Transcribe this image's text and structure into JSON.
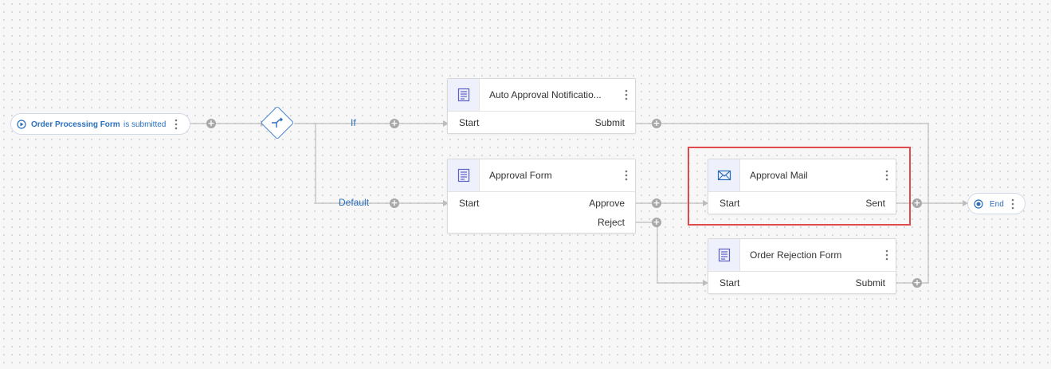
{
  "trigger": {
    "form_name": "Order Processing Form",
    "event": "is submitted"
  },
  "branches": {
    "if_label": "If",
    "default_label": "Default"
  },
  "nodes": {
    "auto_approval": {
      "title": "Auto Approval Notificatio...",
      "icon": "form-icon",
      "port_in": "Start",
      "port_out": "Submit"
    },
    "approval_form": {
      "title": "Approval Form",
      "icon": "form-icon",
      "port_in": "Start",
      "port_out_1": "Approve",
      "port_out_2": "Reject"
    },
    "approval_mail": {
      "title": "Approval Mail",
      "icon": "mail-icon",
      "port_in": "Start",
      "port_out": "Sent"
    },
    "order_rejection": {
      "title": "Order Rejection Form",
      "icon": "form-icon",
      "port_in": "Start",
      "port_out": "Submit"
    }
  },
  "end": {
    "label": "End"
  },
  "colors": {
    "accent": "#2a6ebb",
    "connector": "#b8b8b8",
    "highlight": "#e04a4a",
    "node_icon_bg": "#eef0fb",
    "form_icon": "#5b5fc7",
    "mail_icon": "#2a6ebb"
  }
}
